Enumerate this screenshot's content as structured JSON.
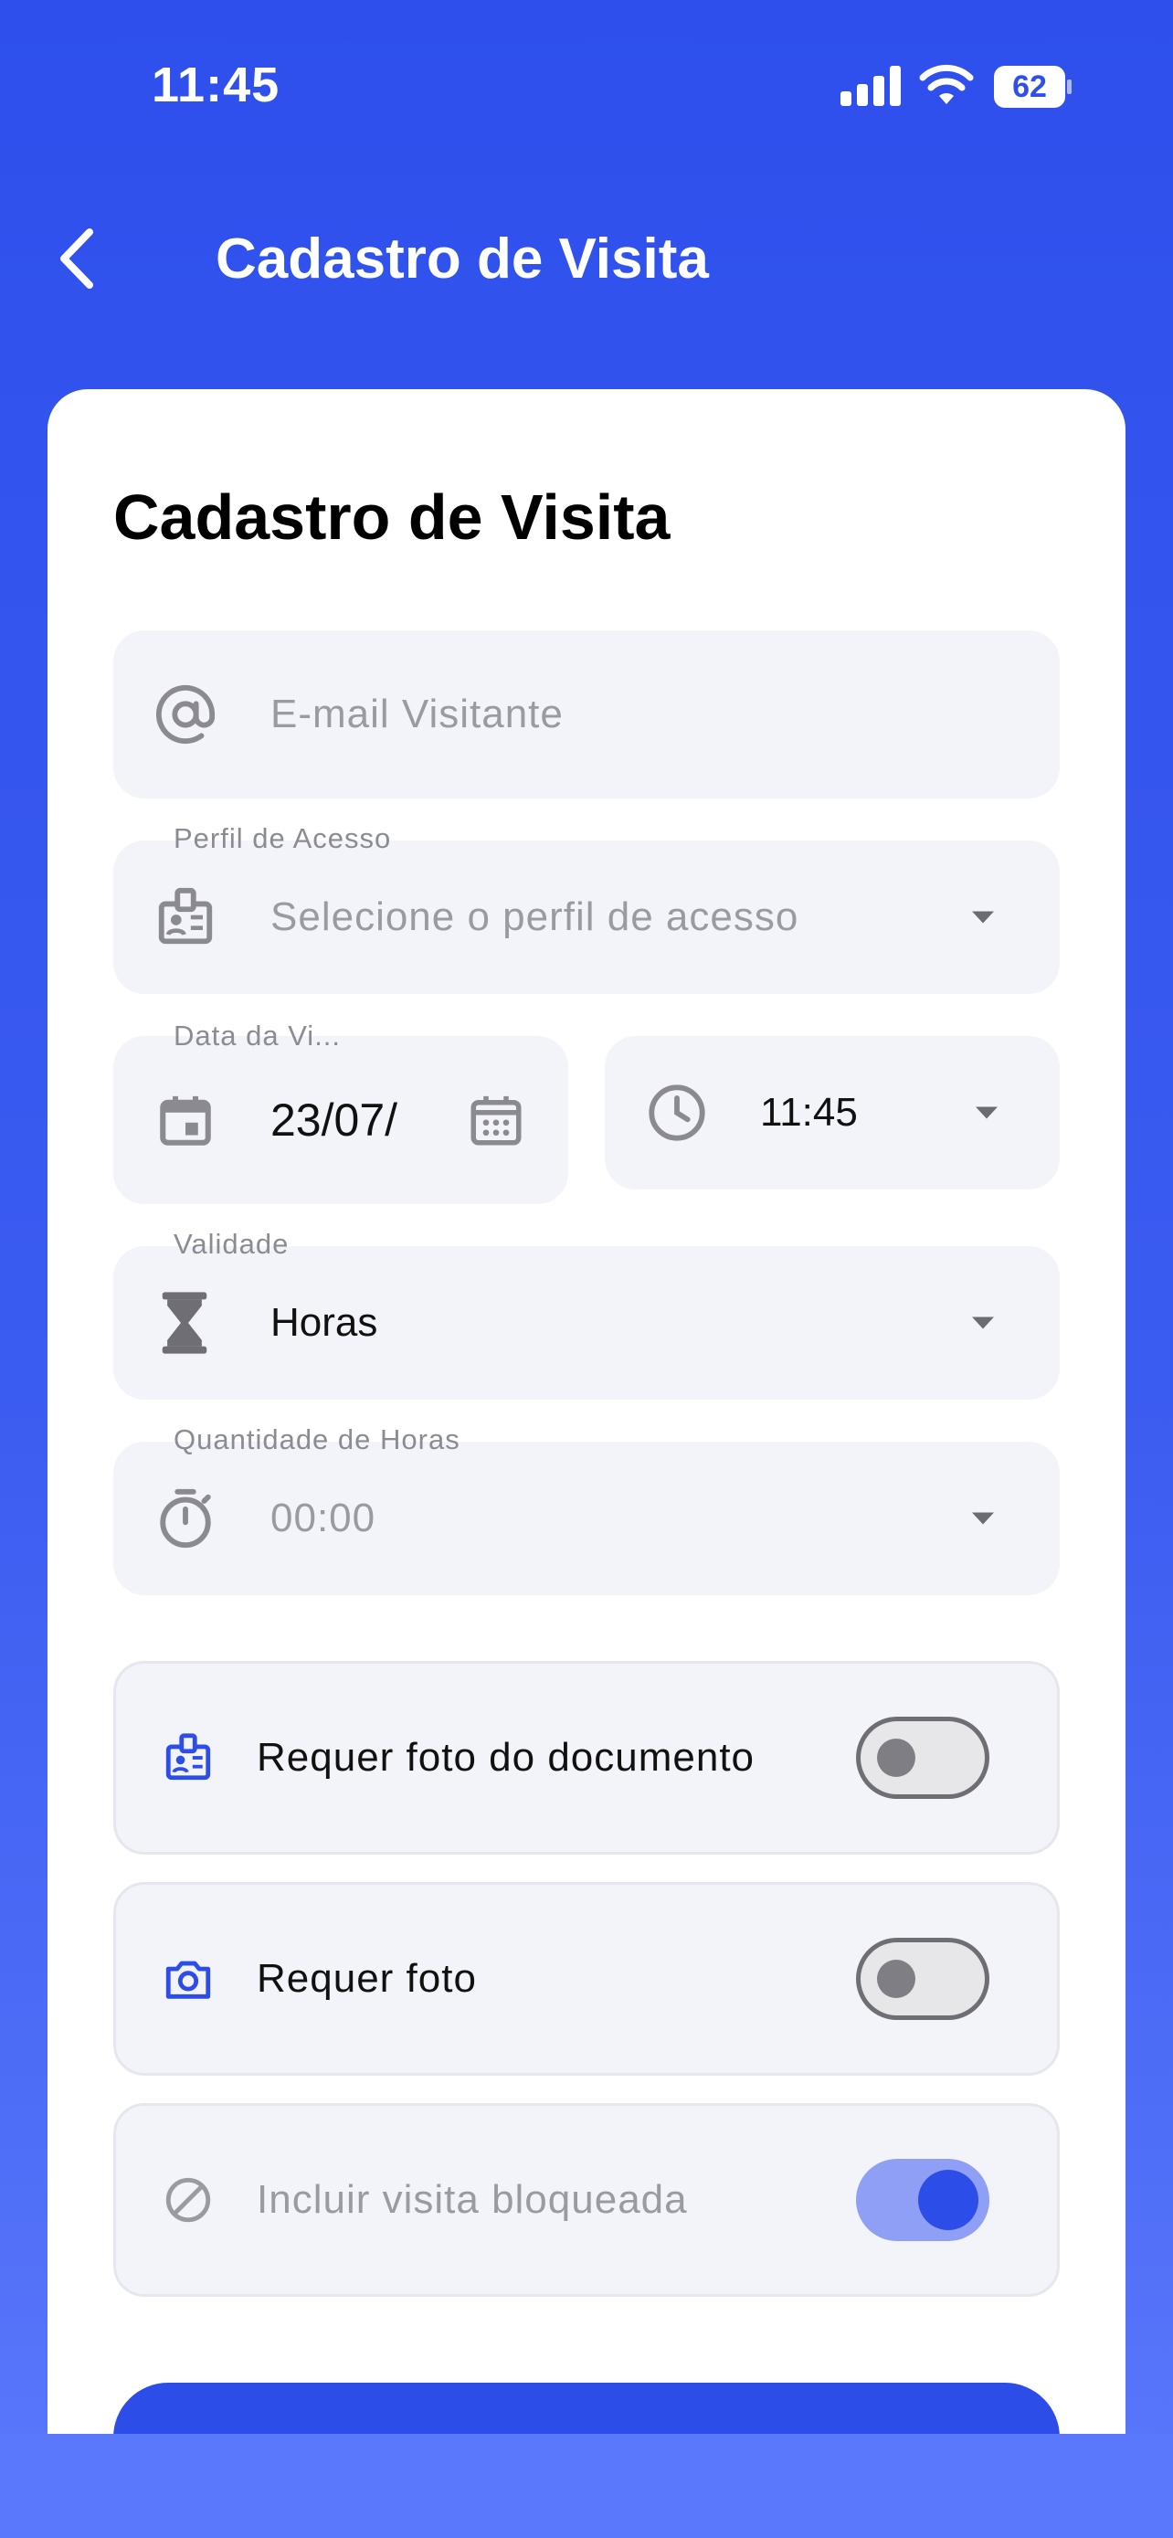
{
  "status_bar": {
    "time": "11:45",
    "battery": "62"
  },
  "header": {
    "title": "Cadastro de Visita"
  },
  "card": {
    "title": "Cadastro de Visita"
  },
  "form": {
    "email": {
      "placeholder": "E-mail Visitante"
    },
    "perfil": {
      "label": "Perfil de Acesso",
      "placeholder": "Selecione o perfil de acesso"
    },
    "data": {
      "label": "Data da Vi...",
      "value": "23/07/"
    },
    "hora": {
      "value": "11:45"
    },
    "validade": {
      "label": "Validade",
      "value": "Horas"
    },
    "quantidade": {
      "label": "Quantidade de Horas",
      "placeholder": "00:00"
    }
  },
  "toggles": [
    {
      "label": "Requer foto do documento",
      "state": false,
      "icon": "id-badge-icon"
    },
    {
      "label": "Requer foto",
      "state": false,
      "icon": "camera-icon"
    },
    {
      "label": "Incluir visita bloqueada",
      "state": true,
      "icon": "blocked-icon",
      "disabled": true
    }
  ],
  "colors": {
    "primary": "#2d4de8",
    "field_bg": "#f3f4f9",
    "placeholder": "#9a9aa2"
  }
}
